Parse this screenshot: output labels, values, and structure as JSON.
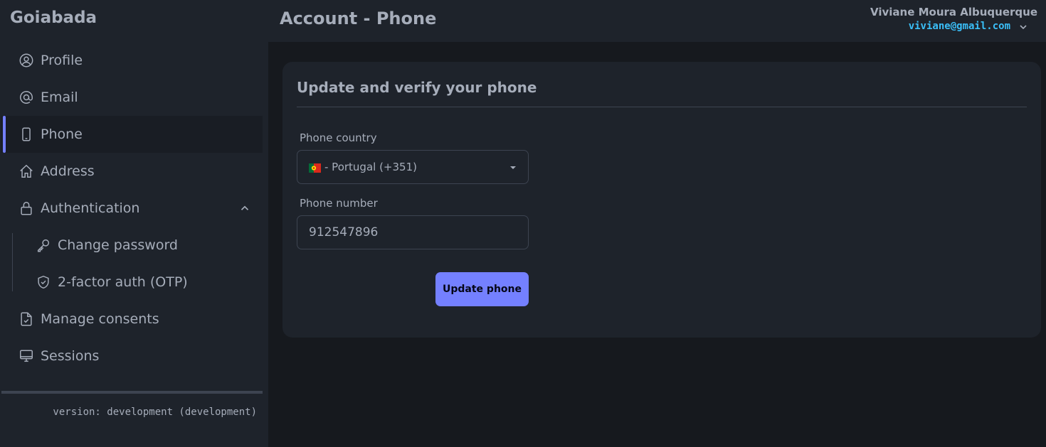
{
  "app": {
    "brand": "Goiabada"
  },
  "header": {
    "title": "Account - Phone",
    "user_name": "Viviane Moura Albuquerque",
    "user_email": "viviane@gmail.com"
  },
  "sidebar": {
    "items": [
      {
        "label": "Profile",
        "icon": "user-circle-icon"
      },
      {
        "label": "Email",
        "icon": "at-sign-icon"
      },
      {
        "label": "Phone",
        "icon": "phone-icon",
        "active": true
      },
      {
        "label": "Address",
        "icon": "home-icon"
      },
      {
        "label": "Authentication",
        "icon": "lock-icon",
        "expanded": true
      },
      {
        "label": "Manage consents",
        "icon": "document-check-icon"
      },
      {
        "label": "Sessions",
        "icon": "monitor-icon"
      }
    ],
    "sub_items": [
      {
        "label": "Change password",
        "icon": "key-icon"
      },
      {
        "label": "2-factor auth (OTP)",
        "icon": "shield-check-icon"
      }
    ],
    "version": "version: development (development)"
  },
  "form": {
    "title": "Update and verify your phone",
    "country_label": "Phone country",
    "country_value": "- Portugal (+351)",
    "number_label": "Phone number",
    "number_value": "912547896",
    "submit_label": "Update phone"
  },
  "colors": {
    "accent": "#7480ff",
    "email": "#3abff8",
    "background": "#16191e",
    "panel": "#1e232b"
  }
}
